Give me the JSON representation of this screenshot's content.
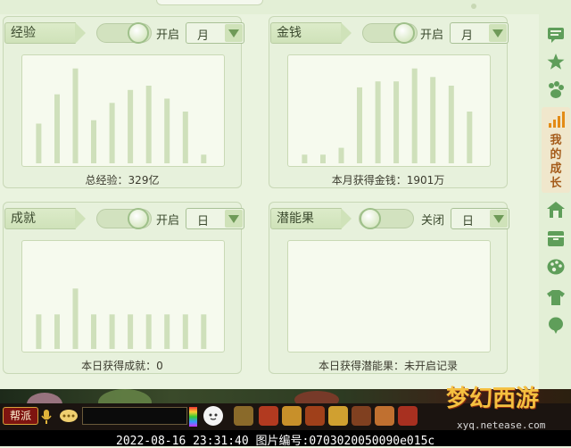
{
  "panels": [
    {
      "title": "经验",
      "toggle_label": "开启",
      "toggle_on": true,
      "period": "月",
      "summary": "总经验：329亿",
      "chart_data": {
        "type": "bar",
        "values": [
          46,
          80,
          110,
          50,
          70,
          85,
          90,
          75,
          60,
          10
        ],
        "ylim": [
          0,
          120
        ]
      }
    },
    {
      "title": "金钱",
      "toggle_label": "开启",
      "toggle_on": true,
      "period": "月",
      "summary": "本月获得金钱：1901万",
      "chart_data": {
        "type": "bar",
        "values": [
          10,
          10,
          18,
          88,
          95,
          95,
          110,
          100,
          90,
          60
        ],
        "ylim": [
          0,
          120
        ]
      }
    },
    {
      "title": "成就",
      "toggle_label": "开启",
      "toggle_on": true,
      "period": "日",
      "summary": "本日获得成就：0",
      "chart_data": {
        "type": "bar",
        "values": [
          40,
          40,
          70,
          40,
          40,
          40,
          40,
          40,
          40,
          40
        ],
        "ylim": [
          0,
          120
        ]
      }
    },
    {
      "title": "潜能果",
      "toggle_label": "关闭",
      "toggle_on": false,
      "period": "日",
      "summary": "本日获得潜能果：未开启记录",
      "chart_data": {
        "type": "bar",
        "values": [],
        "ylim": [
          0,
          120
        ]
      }
    }
  ],
  "sidebar": {
    "active_label": "我的成长",
    "icons": [
      "message-icon",
      "star-icon",
      "paw-icon",
      "growth-bars-icon",
      "home-icon",
      "box-icon",
      "palette-icon",
      "shirt-icon",
      "balloon-icon"
    ]
  },
  "bottom": {
    "guild_button": "帮派",
    "logo_text": "梦幻西游",
    "watermark": "xyq.netease.com",
    "timestamp": "2022-08-16 23:31:40 图片编号:0703020050090e015c"
  },
  "colors": {
    "bar": "#cfe0bb",
    "panel": "#e7f1dc",
    "accent": "#e38b16"
  }
}
